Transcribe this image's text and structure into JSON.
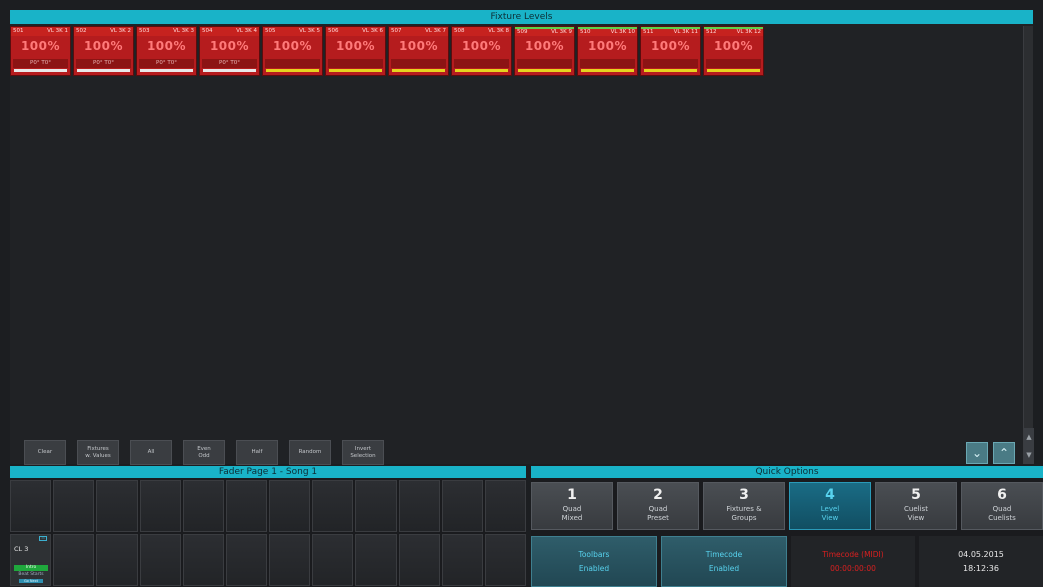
{
  "fixture_panel": {
    "title": "Fixture Levels",
    "fixtures": [
      {
        "id": "501",
        "name": "VL 3K 1",
        "level": "100%",
        "sub": "P0°   T0°",
        "bar": "#e8e8e8",
        "green": false
      },
      {
        "id": "502",
        "name": "VL 3K 2",
        "level": "100%",
        "sub": "P0°   T0°",
        "bar": "#e8e8e8",
        "green": false
      },
      {
        "id": "503",
        "name": "VL 3K 3",
        "level": "100%",
        "sub": "P0°   T0°",
        "bar": "#e8e8e8",
        "green": false
      },
      {
        "id": "504",
        "name": "VL 3K 4",
        "level": "100%",
        "sub": "P0°   T0°",
        "bar": "#e8e8e8",
        "green": false
      },
      {
        "id": "505",
        "name": "VL 3K 5",
        "level": "100%",
        "sub": "",
        "bar": "#e5d31f",
        "green": false
      },
      {
        "id": "506",
        "name": "VL 3K 6",
        "level": "100%",
        "sub": "",
        "bar": "#e5d31f",
        "green": false
      },
      {
        "id": "507",
        "name": "VL 3K 7",
        "level": "100%",
        "sub": "",
        "bar": "#e5d31f",
        "green": false
      },
      {
        "id": "508",
        "name": "VL 3K 8",
        "level": "100%",
        "sub": "",
        "bar": "#e5d31f",
        "green": false
      },
      {
        "id": "509",
        "name": "VL 3K 9",
        "level": "100%",
        "sub": "",
        "bar": "#e5d31f",
        "green": true
      },
      {
        "id": "510",
        "name": "VL 3K 10",
        "level": "100%",
        "sub": "",
        "bar": "#e5d31f",
        "green": true
      },
      {
        "id": "511",
        "name": "VL 3K 11",
        "level": "100%",
        "sub": "",
        "bar": "#e5d31f",
        "green": true
      },
      {
        "id": "512",
        "name": "VL 3K 12",
        "level": "100%",
        "sub": "",
        "bar": "#e5d31f",
        "green": true
      }
    ]
  },
  "selection_buttons": [
    {
      "label": "Clear"
    },
    {
      "label": "Fixtures\nw. Values"
    },
    {
      "label": "All"
    },
    {
      "label": "Even\nOdd"
    },
    {
      "label": "Half"
    },
    {
      "label": "Random"
    },
    {
      "label": "Invert\nSelection"
    }
  ],
  "nav": {
    "down_icon": "double-chevron-down-icon",
    "up_icon": "double-chevron-up-icon"
  },
  "fader_panel": {
    "title": "Fader Page 1 - Song 1",
    "cuelist": {
      "label": "CL 3",
      "tag1": "Intro",
      "tag2": "Beat Starts",
      "tag3": "Go Next"
    }
  },
  "quick_panel": {
    "title": "Quick Options",
    "options": [
      {
        "n": "1",
        "l": "Quad\nMixed",
        "active": false
      },
      {
        "n": "2",
        "l": "Quad\nPreset",
        "active": false
      },
      {
        "n": "3",
        "l": "Fixtures &\nGroups",
        "active": false
      },
      {
        "n": "4",
        "l": "Level\nView",
        "active": true
      },
      {
        "n": "5",
        "l": "Cuelist\nView",
        "active": false
      },
      {
        "n": "6",
        "l": "Quad\nCuelists",
        "active": false
      }
    ],
    "toolbars": {
      "l1": "Toolbars",
      "l2": "Enabled"
    },
    "timecode": {
      "l1": "Timecode",
      "l2": "Enabled"
    },
    "timecode_midi": {
      "l1": "Timecode (MIDI)",
      "l2": "00:00:00:00"
    },
    "datetime": {
      "date": "04.05.2015",
      "time": "18:12:36"
    }
  },
  "colors": {
    "accent": "#19b3c8",
    "fixture_red": "#b51c1e",
    "active_teal": "#58d3ef"
  }
}
